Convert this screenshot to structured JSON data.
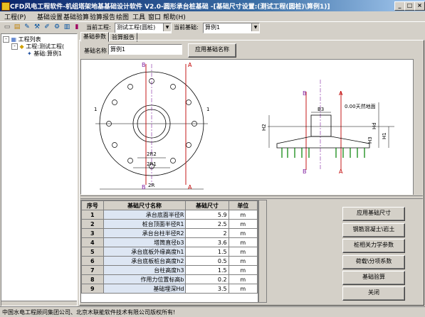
{
  "window": {
    "title": "CFD风电工程软件-机组塔架地基基础设计软件 V2.0-圆形承台桩基础 -[基础尺寸设置:(测试工程(圆桩)\\算例1)]"
  },
  "menu": [
    "工程(P)",
    "基础设置",
    "基础验算",
    "验算报告",
    "绘图",
    "工具",
    "窗口",
    "帮助(H)"
  ],
  "toolbar": {
    "project_label": "当前工程:",
    "project_value": "测试工程(圆桩)",
    "foundation_label": "当前基础:",
    "foundation_value": "算例1"
  },
  "tree": {
    "root": "工程列表",
    "project": "工程:测试工程(",
    "foundation": "基础:算例1"
  },
  "tabs": [
    "基础参数",
    "验算报告"
  ],
  "form": {
    "name_label": "基础名称",
    "name_value": "算例1",
    "apply_name_button": "应用基础名称"
  },
  "drawing": {
    "plan": {
      "section_b": "B",
      "section_a": "A",
      "mark_1": "1",
      "dim_2r2": "2R2",
      "dim_2r1": "2R1",
      "dim_2r": "2R"
    },
    "section": {
      "mark_b": "B",
      "mark_a": "A",
      "dim_h3": "H3",
      "dim_h1": "H1",
      "dim_h2": "H2",
      "dim_hd": "Hd",
      "dim_b3": "B3",
      "ground": "0.00天然地面"
    }
  },
  "table": {
    "headers": [
      "序号",
      "基础尺寸名称",
      "基础尺寸",
      "单位"
    ],
    "rows": [
      [
        "1",
        "承台底面半径R",
        "5.9",
        "m"
      ],
      [
        "2",
        "桩台顶面半径R1",
        "2.5",
        "m"
      ],
      [
        "3",
        "承台台柱半径R2",
        "2",
        "m"
      ],
      [
        "4",
        "塔筒直径b3",
        "3.6",
        "m"
      ],
      [
        "5",
        "承台底板外缘高度h1",
        "1.5",
        "m"
      ],
      [
        "6",
        "承台底板桩台高度h2",
        "0.5",
        "m"
      ],
      [
        "7",
        "台柱高度h3",
        "1.5",
        "m"
      ],
      [
        "8",
        "作用力位置标高b",
        "0.2",
        "m"
      ],
      [
        "9",
        "基础埋深Hd",
        "3.5",
        "m"
      ]
    ]
  },
  "buttons": [
    "应用基础尺寸",
    "钢筋混凝土\\岩土",
    "桩相关力学参数",
    "荷载\\分项系数",
    "基础验算",
    "关闭"
  ],
  "status": "中国水电工程顾问集团公司、北京木联能软件技术有限公司版权所有!",
  "colors": {
    "section_red": "#c00000",
    "section_purple": "#8020a0",
    "pile_green": "#008000",
    "title_blue": "#0a246a"
  }
}
